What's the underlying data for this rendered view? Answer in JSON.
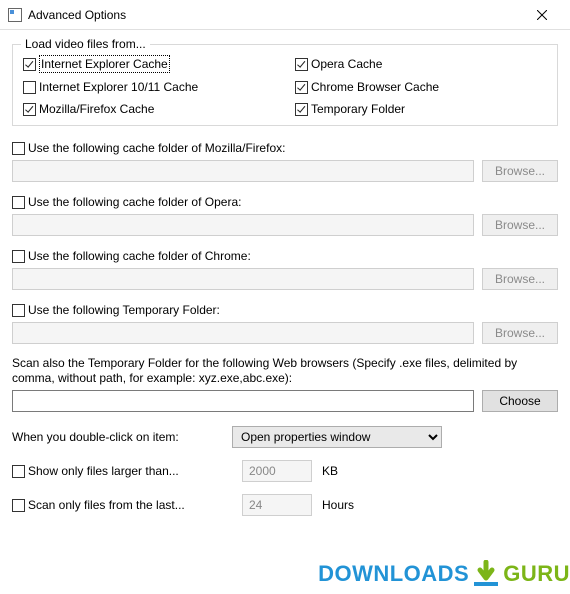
{
  "window": {
    "title": "Advanced Options"
  },
  "group": {
    "legend": "Load video files from...",
    "items": [
      {
        "label": "Internet Explorer Cache",
        "checked": true,
        "focus": true
      },
      {
        "label": "Opera Cache",
        "checked": true,
        "focus": false
      },
      {
        "label": "Internet Explorer 10/11 Cache",
        "checked": false,
        "focus": false
      },
      {
        "label": "Chrome Browser Cache",
        "checked": true,
        "focus": false
      },
      {
        "label": "Mozilla/Firefox Cache",
        "checked": true,
        "focus": false
      },
      {
        "label": "Temporary Folder",
        "checked": true,
        "focus": false
      }
    ]
  },
  "folders": [
    {
      "label": "Use the following cache folder of Mozilla/Firefox:",
      "checked": false,
      "btn": "Browse..."
    },
    {
      "label": "Use the following cache folder of Opera:",
      "checked": false,
      "btn": "Browse..."
    },
    {
      "label": "Use the following cache folder of Chrome:",
      "checked": false,
      "btn": "Browse..."
    },
    {
      "label": "Use the following Temporary Folder:",
      "checked": false,
      "btn": "Browse..."
    }
  ],
  "scanAlso": {
    "desc": "Scan also the Temporary Folder for the following Web browsers (Specify .exe files, delimited by comma, without path, for example: xyz.exe,abc.exe):",
    "btn": "Choose"
  },
  "dblclick": {
    "label": "When you double-click on item:",
    "value": "Open properties window"
  },
  "filters": {
    "larger": {
      "label": "Show only files larger than...",
      "value": "2000",
      "unit": "KB",
      "checked": false
    },
    "last": {
      "label": "Scan only files from the last...",
      "value": "24",
      "unit": "Hours",
      "checked": false
    }
  },
  "watermark": {
    "left": "DOWNLOADS",
    "right": "GURU"
  }
}
